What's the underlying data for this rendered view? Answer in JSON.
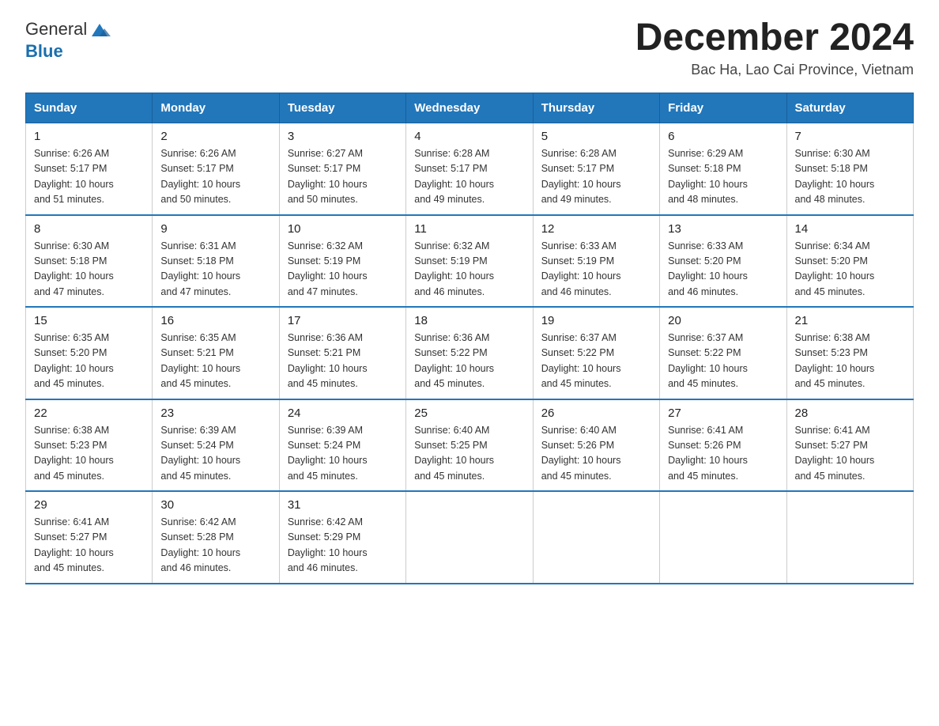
{
  "header": {
    "logo_text_general": "General",
    "logo_text_blue": "Blue",
    "month_title": "December 2024",
    "location": "Bac Ha, Lao Cai Province, Vietnam"
  },
  "weekdays": [
    "Sunday",
    "Monday",
    "Tuesday",
    "Wednesday",
    "Thursday",
    "Friday",
    "Saturday"
  ],
  "weeks": [
    [
      {
        "day": "1",
        "sunrise": "6:26 AM",
        "sunset": "5:17 PM",
        "daylight": "10 hours and 51 minutes."
      },
      {
        "day": "2",
        "sunrise": "6:26 AM",
        "sunset": "5:17 PM",
        "daylight": "10 hours and 50 minutes."
      },
      {
        "day": "3",
        "sunrise": "6:27 AM",
        "sunset": "5:17 PM",
        "daylight": "10 hours and 50 minutes."
      },
      {
        "day": "4",
        "sunrise": "6:28 AM",
        "sunset": "5:17 PM",
        "daylight": "10 hours and 49 minutes."
      },
      {
        "day": "5",
        "sunrise": "6:28 AM",
        "sunset": "5:17 PM",
        "daylight": "10 hours and 49 minutes."
      },
      {
        "day": "6",
        "sunrise": "6:29 AM",
        "sunset": "5:18 PM",
        "daylight": "10 hours and 48 minutes."
      },
      {
        "day": "7",
        "sunrise": "6:30 AM",
        "sunset": "5:18 PM",
        "daylight": "10 hours and 48 minutes."
      }
    ],
    [
      {
        "day": "8",
        "sunrise": "6:30 AM",
        "sunset": "5:18 PM",
        "daylight": "10 hours and 47 minutes."
      },
      {
        "day": "9",
        "sunrise": "6:31 AM",
        "sunset": "5:18 PM",
        "daylight": "10 hours and 47 minutes."
      },
      {
        "day": "10",
        "sunrise": "6:32 AM",
        "sunset": "5:19 PM",
        "daylight": "10 hours and 47 minutes."
      },
      {
        "day": "11",
        "sunrise": "6:32 AM",
        "sunset": "5:19 PM",
        "daylight": "10 hours and 46 minutes."
      },
      {
        "day": "12",
        "sunrise": "6:33 AM",
        "sunset": "5:19 PM",
        "daylight": "10 hours and 46 minutes."
      },
      {
        "day": "13",
        "sunrise": "6:33 AM",
        "sunset": "5:20 PM",
        "daylight": "10 hours and 46 minutes."
      },
      {
        "day": "14",
        "sunrise": "6:34 AM",
        "sunset": "5:20 PM",
        "daylight": "10 hours and 45 minutes."
      }
    ],
    [
      {
        "day": "15",
        "sunrise": "6:35 AM",
        "sunset": "5:20 PM",
        "daylight": "10 hours and 45 minutes."
      },
      {
        "day": "16",
        "sunrise": "6:35 AM",
        "sunset": "5:21 PM",
        "daylight": "10 hours and 45 minutes."
      },
      {
        "day": "17",
        "sunrise": "6:36 AM",
        "sunset": "5:21 PM",
        "daylight": "10 hours and 45 minutes."
      },
      {
        "day": "18",
        "sunrise": "6:36 AM",
        "sunset": "5:22 PM",
        "daylight": "10 hours and 45 minutes."
      },
      {
        "day": "19",
        "sunrise": "6:37 AM",
        "sunset": "5:22 PM",
        "daylight": "10 hours and 45 minutes."
      },
      {
        "day": "20",
        "sunrise": "6:37 AM",
        "sunset": "5:22 PM",
        "daylight": "10 hours and 45 minutes."
      },
      {
        "day": "21",
        "sunrise": "6:38 AM",
        "sunset": "5:23 PM",
        "daylight": "10 hours and 45 minutes."
      }
    ],
    [
      {
        "day": "22",
        "sunrise": "6:38 AM",
        "sunset": "5:23 PM",
        "daylight": "10 hours and 45 minutes."
      },
      {
        "day": "23",
        "sunrise": "6:39 AM",
        "sunset": "5:24 PM",
        "daylight": "10 hours and 45 minutes."
      },
      {
        "day": "24",
        "sunrise": "6:39 AM",
        "sunset": "5:24 PM",
        "daylight": "10 hours and 45 minutes."
      },
      {
        "day": "25",
        "sunrise": "6:40 AM",
        "sunset": "5:25 PM",
        "daylight": "10 hours and 45 minutes."
      },
      {
        "day": "26",
        "sunrise": "6:40 AM",
        "sunset": "5:26 PM",
        "daylight": "10 hours and 45 minutes."
      },
      {
        "day": "27",
        "sunrise": "6:41 AM",
        "sunset": "5:26 PM",
        "daylight": "10 hours and 45 minutes."
      },
      {
        "day": "28",
        "sunrise": "6:41 AM",
        "sunset": "5:27 PM",
        "daylight": "10 hours and 45 minutes."
      }
    ],
    [
      {
        "day": "29",
        "sunrise": "6:41 AM",
        "sunset": "5:27 PM",
        "daylight": "10 hours and 45 minutes."
      },
      {
        "day": "30",
        "sunrise": "6:42 AM",
        "sunset": "5:28 PM",
        "daylight": "10 hours and 46 minutes."
      },
      {
        "day": "31",
        "sunrise": "6:42 AM",
        "sunset": "5:29 PM",
        "daylight": "10 hours and 46 minutes."
      },
      null,
      null,
      null,
      null
    ]
  ],
  "labels": {
    "sunrise": "Sunrise:",
    "sunset": "Sunset:",
    "daylight": "Daylight:"
  }
}
